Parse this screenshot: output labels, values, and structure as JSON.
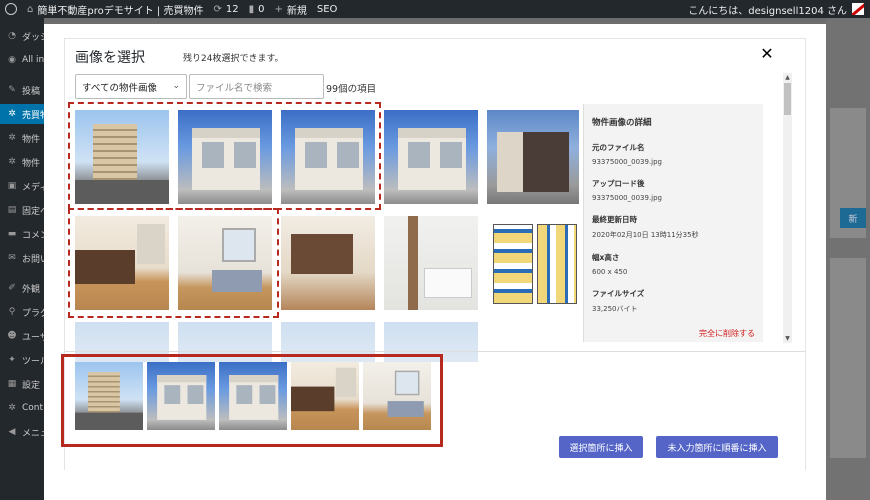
{
  "admin_bar": {
    "site_name": "簡単不動産proデモサイト | 売買物件",
    "updates_count": "12",
    "comments_count": "0",
    "new_label": "新規",
    "seo_label": "SEO",
    "greeting": "こんにちは、designsell1204 さん"
  },
  "sidebar": {
    "items": [
      {
        "label": "ダッシュボード",
        "icon": "dashboard-icon"
      },
      {
        "label": "All in One SEO",
        "icon": "seo-icon"
      },
      {
        "label": "投稿",
        "icon": "pin-icon"
      },
      {
        "label": "売買物件",
        "icon": "gear-icon"
      },
      {
        "label": "物件",
        "icon": "gear-icon"
      },
      {
        "label": "物件",
        "icon": "gear-icon"
      },
      {
        "label": "メディア",
        "icon": "media-icon"
      },
      {
        "label": "固定ページ",
        "icon": "page-icon"
      },
      {
        "label": "コメント",
        "icon": "comment-icon"
      },
      {
        "label": "お問い合わせ",
        "icon": "mail-icon"
      },
      {
        "label": "外観",
        "icon": "brush-icon"
      },
      {
        "label": "プラグイン",
        "icon": "plugin-icon"
      },
      {
        "label": "ユーザー",
        "icon": "user-icon"
      },
      {
        "label": "ツール",
        "icon": "wrench-icon"
      },
      {
        "label": "設定",
        "icon": "settings-icon"
      },
      {
        "label": "Cont",
        "icon": "gear-icon"
      },
      {
        "label": "メニュー",
        "icon": "collapse-icon"
      }
    ]
  },
  "bg": {
    "button_fragment": "新"
  },
  "modal": {
    "title": "画像を選択",
    "subtitle": "残り24枚選択できます。",
    "close_label": "✕",
    "filter_value": "すべての物件画像",
    "search_placeholder": "ファイル名で検索",
    "item_count": "99個の項目"
  },
  "details": {
    "heading": "物件画像の詳細",
    "original_label": "元のファイル名",
    "original_value": "93375000_0039.jpg",
    "uploaded_label": "アップロード後",
    "uploaded_value": "93375000_0039.jpg",
    "updated_label": "最終更新日時",
    "updated_value": "2020年02月10日 13時11分35秒",
    "dims_label": "幅x高さ",
    "dims_value": "600 x 450",
    "size_label": "ファイルサイズ",
    "size_value": "33,250バイト",
    "delete_label": "完全に削除する"
  },
  "buttons": {
    "insert_selected": "選択箇所に挿入",
    "insert_sequential": "未入力箇所に順番に挿入"
  },
  "colors": {
    "admin_bar": "#23282d",
    "active_menu": "#0073aa",
    "selected_border": "#3aa39a",
    "highlight_red": "#b7281f",
    "primary_button": "#5465c7"
  }
}
